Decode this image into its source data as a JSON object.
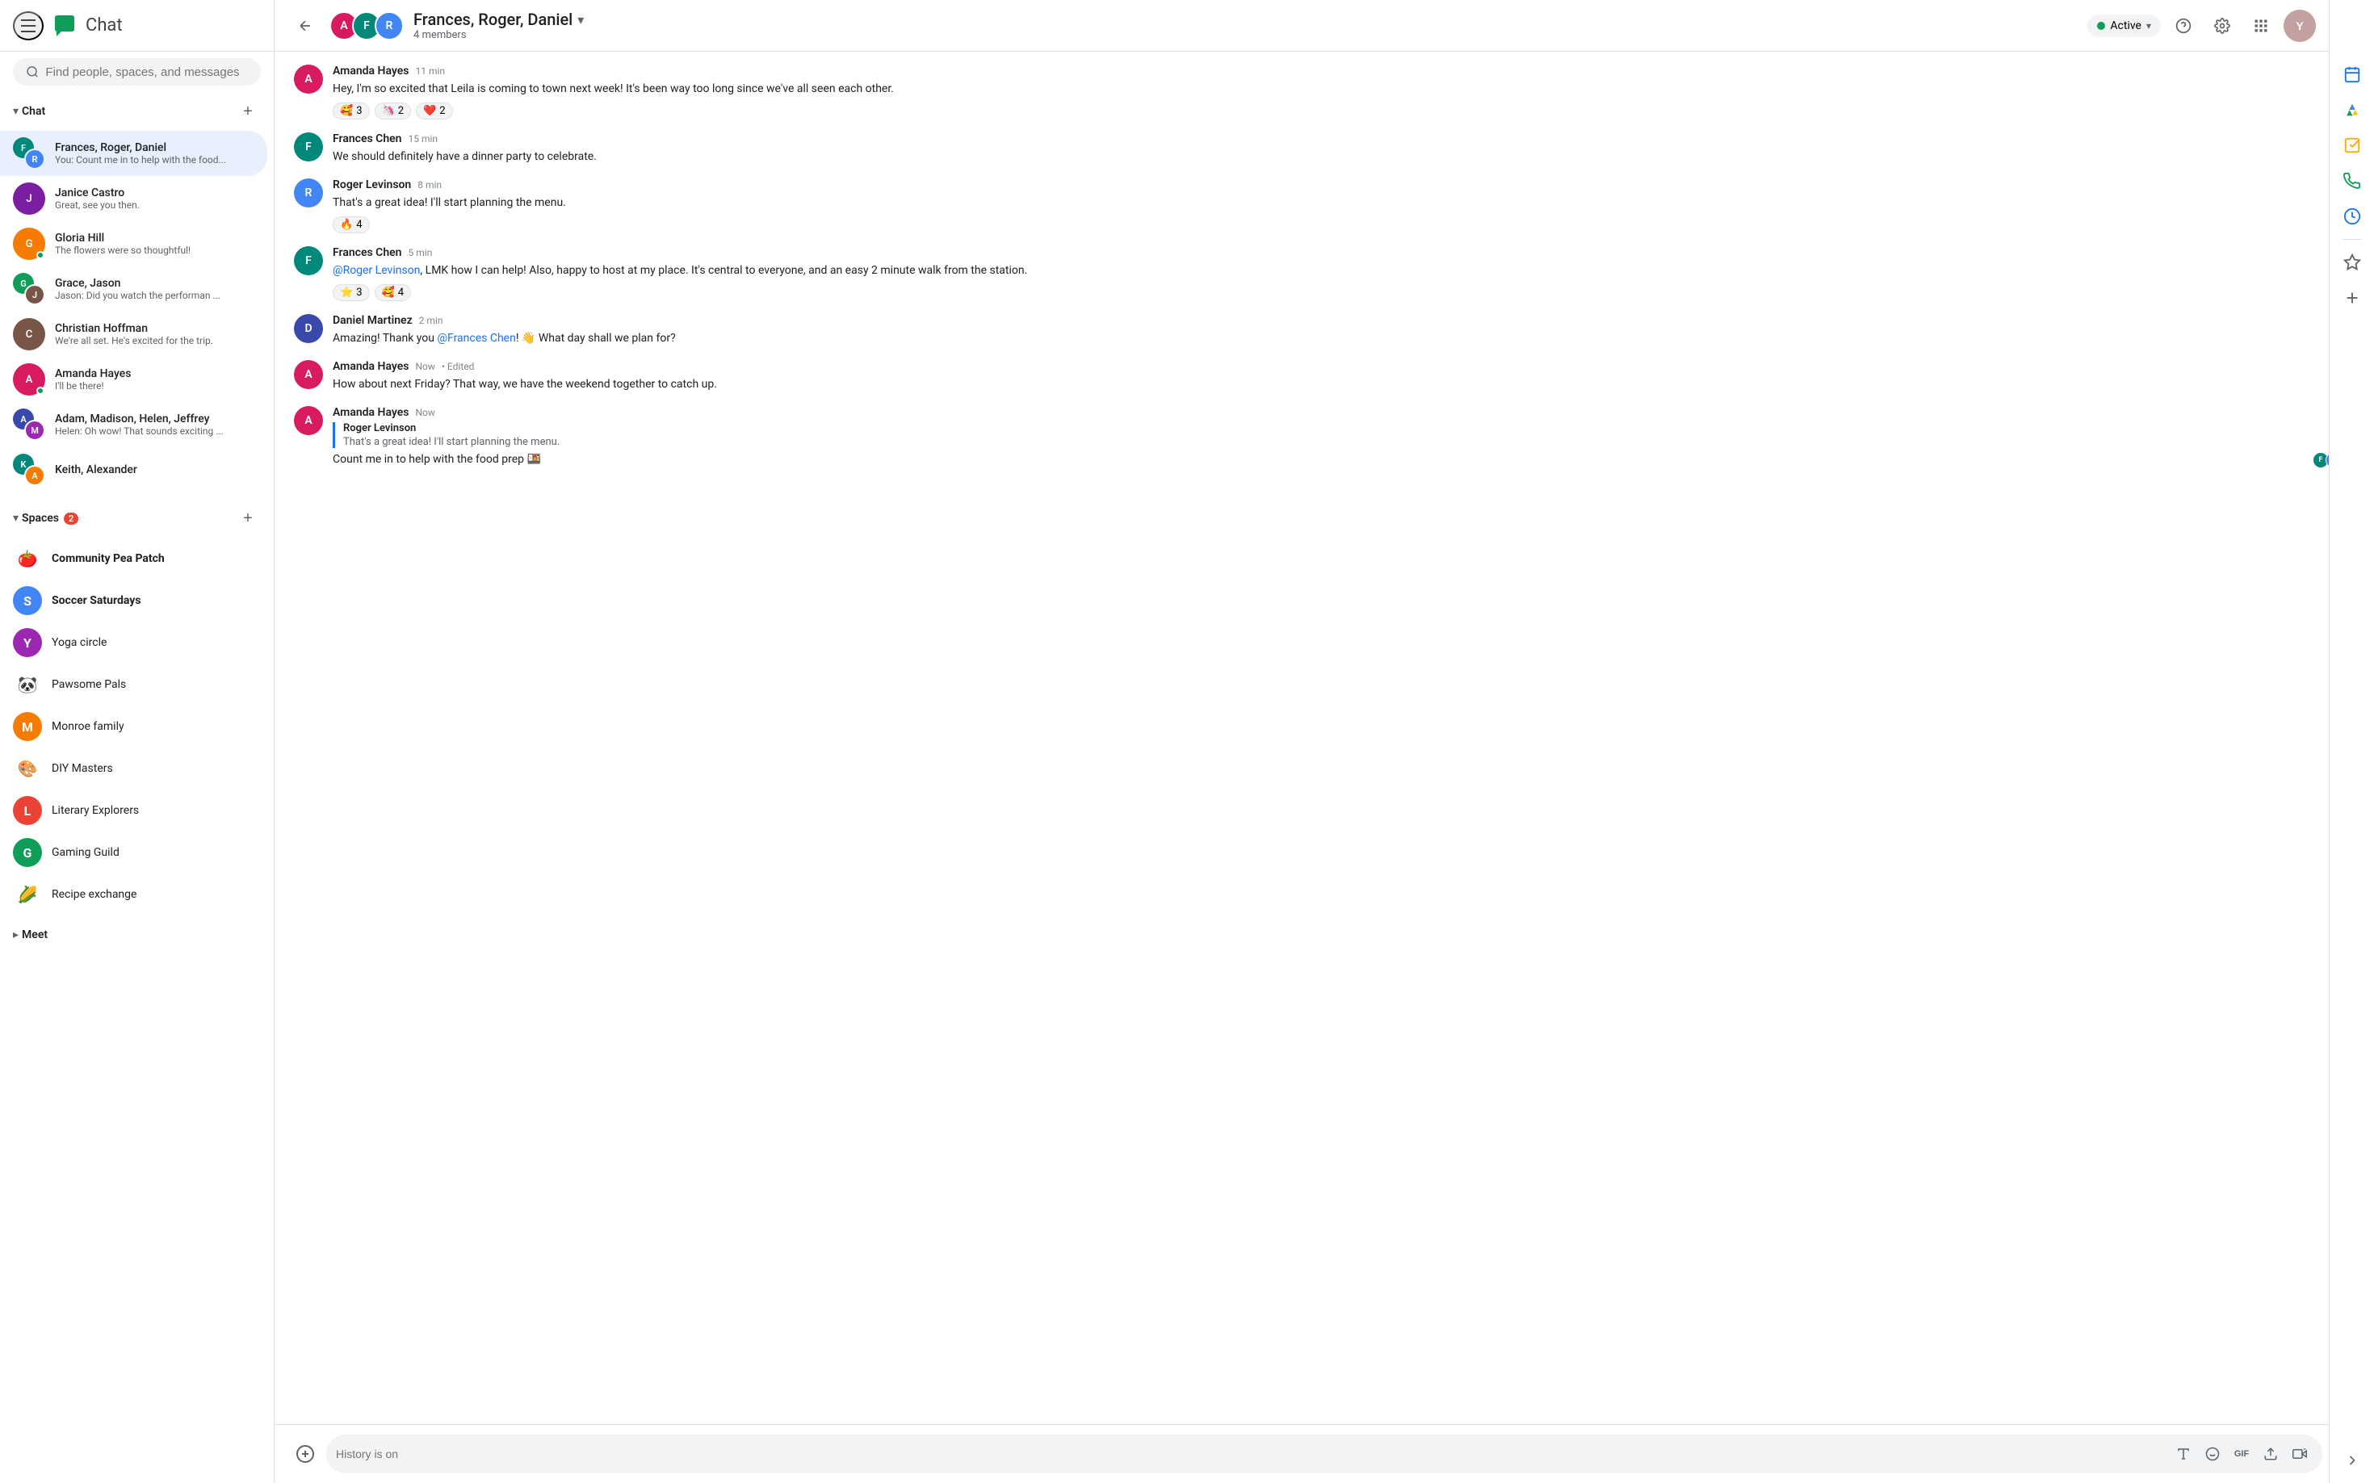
{
  "topbar": {
    "logo_text": "Chat",
    "search_placeholder": "Find people, spaces, and messages",
    "status_label": "Active",
    "status_color": "#0f9d58"
  },
  "sidebar": {
    "chat_section_label": "Chat",
    "spaces_section_label": "Spaces",
    "spaces_badge": "2",
    "meet_section_label": "Meet",
    "chat_items": [
      {
        "id": "frances-roger-daniel",
        "name": "Frances, Roger, Daniel",
        "preview": "You: Count me in to help with the food...",
        "active": true
      },
      {
        "id": "janice-castro",
        "name": "Janice Castro",
        "preview": "Great, see you then.",
        "active": false
      },
      {
        "id": "gloria-hill",
        "name": "Gloria Hill",
        "preview": "The flowers were so thoughtful!",
        "active": false
      },
      {
        "id": "grace-jason",
        "name": "Grace, Jason",
        "preview": "Jason: Did you watch the performan ...",
        "active": false
      },
      {
        "id": "christian-hoffman",
        "name": "Christian Hoffman",
        "preview": "We're all set.  He's excited for the trip.",
        "active": false
      },
      {
        "id": "amanda-hayes",
        "name": "Amanda Hayes",
        "preview": "I'll be there!",
        "active": false
      },
      {
        "id": "adam-madison-helen-jeffrey",
        "name": "Adam, Madison, Helen, Jeffrey",
        "preview": "Helen: Oh wow! That sounds exciting ...",
        "active": false
      },
      {
        "id": "keith-alexander",
        "name": "Keith, Alexander",
        "preview": "",
        "active": false
      }
    ],
    "spaces": [
      {
        "id": "community-pea-patch",
        "name": "Community Pea Patch",
        "icon": "🍅",
        "bold": true
      },
      {
        "id": "soccer-saturdays",
        "name": "Soccer Saturdays",
        "icon": "S",
        "bold": true,
        "icon_bg": "#4285f4",
        "icon_color": "#fff"
      },
      {
        "id": "yoga-circle",
        "name": "Yoga circle",
        "icon": "Y",
        "bold": false,
        "icon_bg": "#9c27b0",
        "icon_color": "#fff"
      },
      {
        "id": "pawsome-pals",
        "name": "Pawsome Pals",
        "icon": "🐼",
        "bold": false
      },
      {
        "id": "monroe-family",
        "name": "Monroe family",
        "icon": "M",
        "bold": false,
        "icon_bg": "#f57c00",
        "icon_color": "#fff"
      },
      {
        "id": "diy-masters",
        "name": "DIY Masters",
        "icon": "🎨",
        "bold": false
      },
      {
        "id": "literary-explorers",
        "name": "Literary Explorers",
        "icon": "L",
        "bold": false,
        "icon_bg": "#ea4335",
        "icon_color": "#fff"
      },
      {
        "id": "gaming-guild",
        "name": "Gaming Guild",
        "icon": "G",
        "bold": false,
        "icon_bg": "#0f9d58",
        "icon_color": "#fff"
      },
      {
        "id": "recipe-exchange",
        "name": "Recipe exchange",
        "icon": "🌽",
        "bold": false
      }
    ]
  },
  "chat": {
    "title": "Frances, Roger, Daniel",
    "members_count": "4 members",
    "messages": [
      {
        "id": "msg1",
        "author": "Amanda Hayes",
        "time": "11 min",
        "text": "Hey, I'm so excited that Leila is coming to town next week! It's been way too long since we've all seen each other.",
        "reactions": [
          {
            "emoji": "🥰",
            "count": "3"
          },
          {
            "emoji": "🦄",
            "count": "2"
          },
          {
            "emoji": "❤️",
            "count": "2"
          }
        ],
        "avatar_color": "av-pink"
      },
      {
        "id": "msg2",
        "author": "Frances Chen",
        "time": "15 min",
        "text": "We should definitely have a dinner party to celebrate.",
        "reactions": [],
        "avatar_color": "av-teal"
      },
      {
        "id": "msg3",
        "author": "Roger Levinson",
        "time": "8 min",
        "text": "That's a great idea! I'll start planning the menu.",
        "reactions": [
          {
            "emoji": "🔥",
            "count": "4"
          }
        ],
        "avatar_color": "av-blue"
      },
      {
        "id": "msg4",
        "author": "Frances Chen",
        "time": "5 min",
        "text_parts": [
          {
            "type": "mention",
            "text": "@Roger Levinson"
          },
          {
            "type": "text",
            "text": ", LMK how I can help!  Also, happy to host at my place. It's central to everyone, and an easy 2 minute walk from the station."
          }
        ],
        "reactions": [
          {
            "emoji": "⭐",
            "count": "3"
          },
          {
            "emoji": "🥰",
            "count": "4"
          }
        ],
        "avatar_color": "av-teal"
      },
      {
        "id": "msg5",
        "author": "Daniel Martinez",
        "time": "2 min",
        "text_parts": [
          {
            "type": "text",
            "text": "Amazing! Thank you "
          },
          {
            "type": "mention",
            "text": "@Frances Chen"
          },
          {
            "type": "text",
            "text": "! 👋 What day shall we plan for?"
          }
        ],
        "reactions": [],
        "avatar_color": "av-indigo"
      },
      {
        "id": "msg6",
        "author": "Amanda Hayes",
        "time": "Now",
        "edited": true,
        "text": "How about next Friday? That way, we have the weekend together to catch up.",
        "reactions": [],
        "avatar_color": "av-pink"
      },
      {
        "id": "msg7",
        "author": "Amanda Hayes",
        "time": "Now",
        "quote": {
          "author": "Roger Levinson",
          "text": "That's a great idea! I'll start planning the menu."
        },
        "text": "Count me in to help with the food prep 🍱",
        "reactions": [],
        "avatar_color": "av-pink",
        "show_seen_avatars": true
      }
    ],
    "input_placeholder": "History is on"
  },
  "right_sidebar_icons": [
    {
      "id": "calendar-icon",
      "symbol": "📅"
    },
    {
      "id": "drive-icon",
      "symbol": "△"
    },
    {
      "id": "tasks-icon",
      "symbol": "✓"
    },
    {
      "id": "phone-icon",
      "symbol": "📞"
    },
    {
      "id": "todo-icon",
      "symbol": "◎"
    },
    {
      "id": "star-icon",
      "symbol": "☆"
    },
    {
      "id": "plus-icon",
      "symbol": "+"
    }
  ]
}
